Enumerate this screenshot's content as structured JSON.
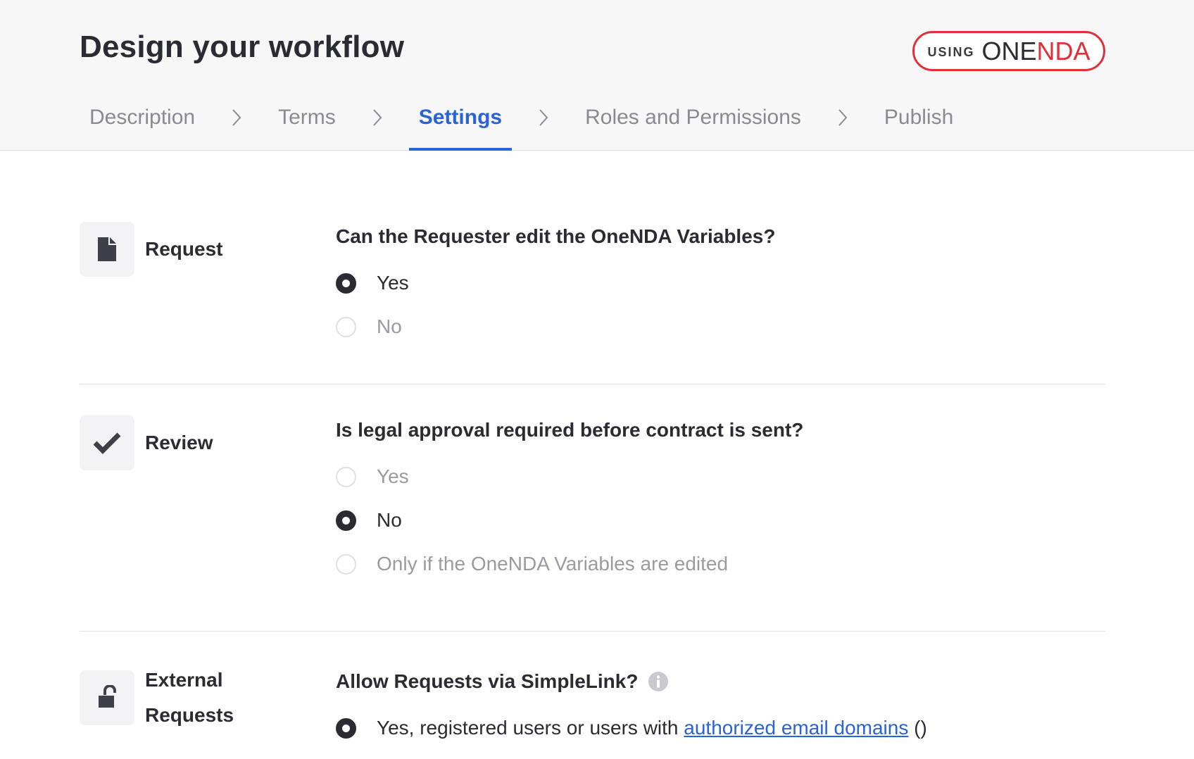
{
  "header": {
    "title": "Design your workflow",
    "badge": {
      "using": "USING",
      "one": "ONE",
      "nda": "NDA"
    }
  },
  "tabs": [
    {
      "label": "Description"
    },
    {
      "label": "Terms"
    },
    {
      "label": "Settings",
      "active": true
    },
    {
      "label": "Roles and Permissions"
    },
    {
      "label": "Publish"
    }
  ],
  "sections": {
    "request": {
      "label": "Request",
      "icon": "document-icon",
      "question": "Can the Requester edit the OneNDA Variables?",
      "options": [
        {
          "label": "Yes",
          "selected": true
        },
        {
          "label": "No",
          "selected": false
        }
      ]
    },
    "review": {
      "label": "Review",
      "icon": "checkmark-icon",
      "question": "Is legal approval required before contract is sent?",
      "options": [
        {
          "label": "Yes",
          "selected": false
        },
        {
          "label": "No",
          "selected": true
        },
        {
          "label": "Only if the OneNDA Variables are edited",
          "selected": false
        }
      ]
    },
    "external": {
      "label_line1": "External",
      "label_line2": "Requests",
      "icon": "unlock-icon",
      "question": "Allow Requests via SimpleLink?",
      "options": [
        {
          "label_prefix": "Yes, registered users or users with ",
          "link": "authorized email domains",
          "label_suffix": " ()",
          "selected": true
        }
      ]
    }
  },
  "colors": {
    "accent": "#2a63d4",
    "brand_red": "#e0303a",
    "text": "#2b2b33",
    "muted": "#8a8a92"
  }
}
